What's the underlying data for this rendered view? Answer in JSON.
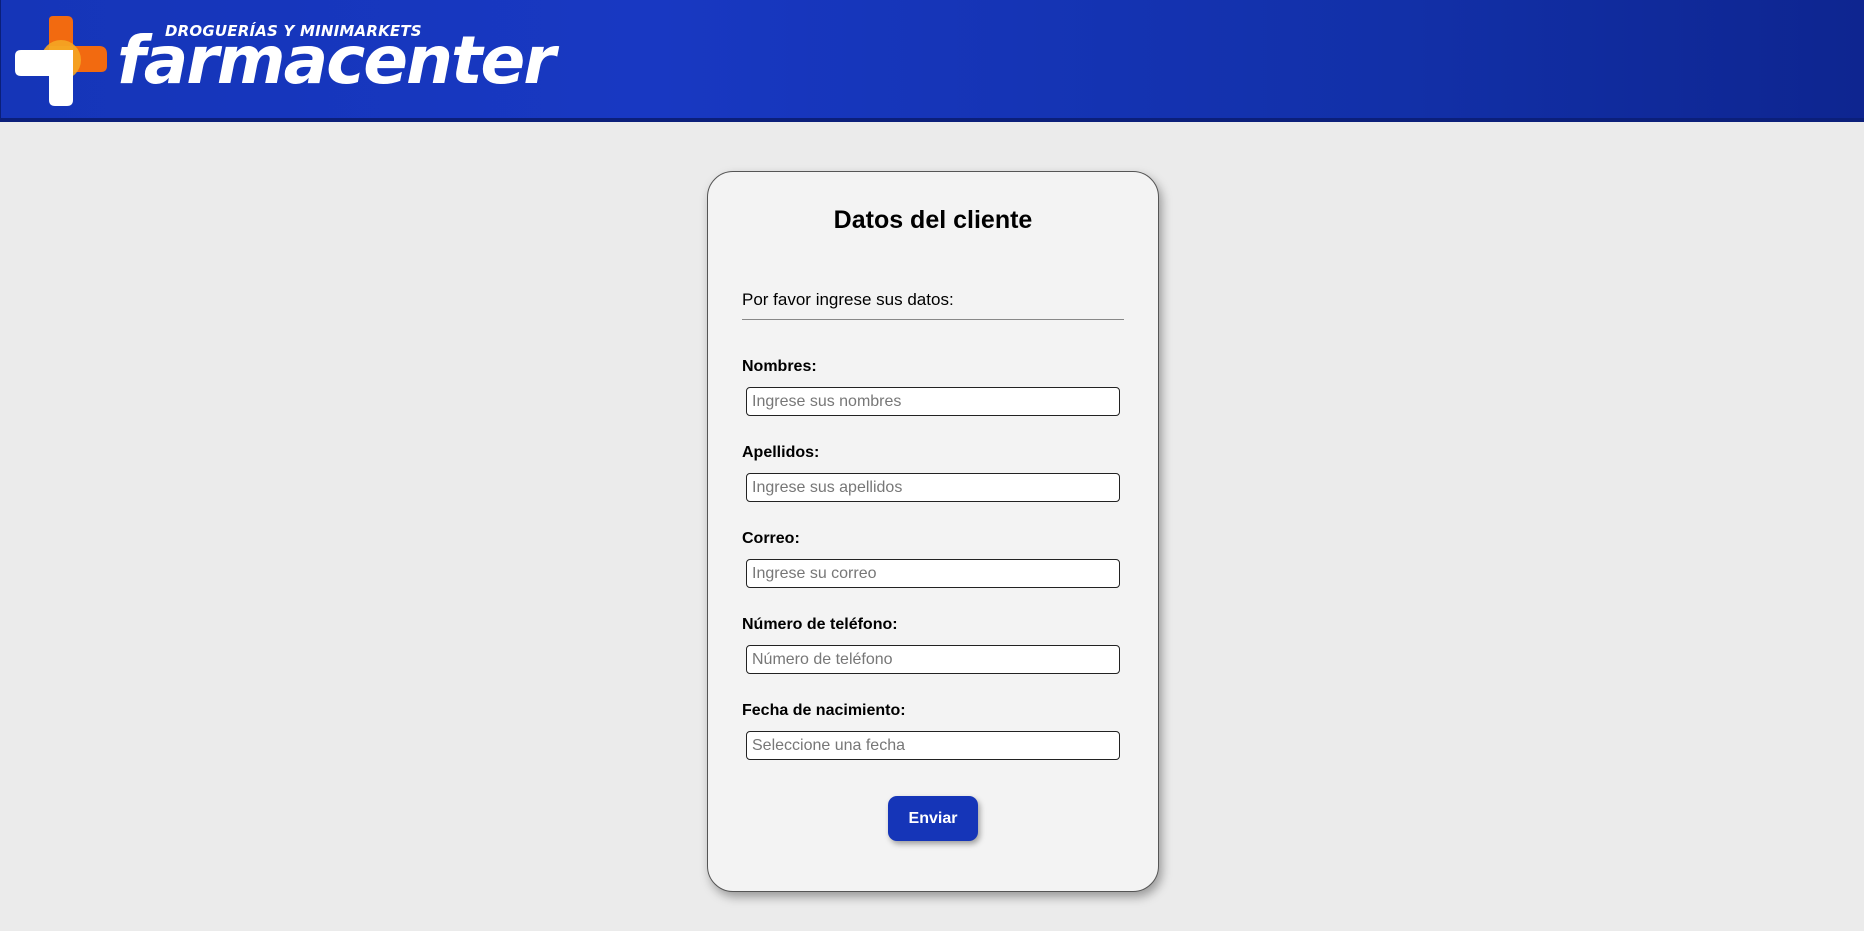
{
  "header": {
    "brand_tagline": "DROGUERÍAS Y MINIMARKETS",
    "brand_name": "farmacenter",
    "logo_icon": "medical-cross-icon",
    "colors": {
      "header_bg": "#1535b8",
      "cross_orange": "#f26a10",
      "cross_yellow": "#f5a623",
      "cross_white": "#ffffff"
    }
  },
  "form": {
    "title": "Datos del cliente",
    "intro": "Por favor ingrese sus datos:",
    "fields": [
      {
        "label": "Nombres:",
        "placeholder": "Ingrese sus nombres",
        "value": ""
      },
      {
        "label": "Apellidos:",
        "placeholder": "Ingrese sus apellidos",
        "value": ""
      },
      {
        "label": "Correo:",
        "placeholder": "Ingrese su correo",
        "value": ""
      },
      {
        "label": "Número de teléfono:",
        "placeholder": "Número de teléfono",
        "value": ""
      },
      {
        "label": "Fecha de nacimiento:",
        "placeholder": "Seleccione una fecha",
        "value": ""
      }
    ],
    "submit_label": "Enviar",
    "accent_color": "#1535b8"
  }
}
